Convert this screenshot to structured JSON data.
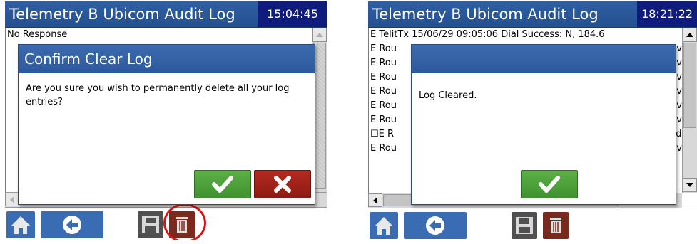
{
  "left_screen": {
    "title": "Telemetry B Ubicom Audit Log",
    "clock": "15:04:45",
    "log_lines": [
      "No Response"
    ],
    "dialog": {
      "title": "Confirm Clear Log",
      "message": "Are you sure you wish to permanently delete all your log entries?",
      "ok_icon": "checkmark-icon",
      "cancel_icon": "x-cross-icon"
    },
    "toolbar": [
      "home-icon",
      "back-arrow-icon",
      "save-disk-icon",
      "trash-icon"
    ],
    "highlight": "trash-button"
  },
  "right_screen": {
    "title": "Telemetry B Ubicom Audit Log",
    "clock": "18:21:22",
    "log_lines": [
      "E TelitTx 15/06/29 09:05:06 Dial Success: N, 184.6",
      "E Rou",
      "E Rou",
      "E Rou",
      "E Rou",
      "E Rou",
      "E Rou",
      "☐E R",
      "E Rou"
    ],
    "log_line_right_fragments": [
      "",
      "t v",
      "t v",
      "t v",
      "t v",
      "t v",
      "t v",
      "nd",
      "t v"
    ],
    "dialog": {
      "title": "",
      "message": "Log Cleared.",
      "ok_icon": "checkmark-icon"
    },
    "toolbar": [
      "home-icon",
      "back-arrow-icon",
      "save-disk-icon",
      "trash-icon"
    ]
  },
  "colors": {
    "titlebar": "#2f5fa3",
    "clock_bg": "#101c7c",
    "ok_green": "#4aa23a",
    "cancel_red": "#a3231a",
    "trash_brown": "#7a2a1c",
    "highlight_red": "#e01010"
  }
}
